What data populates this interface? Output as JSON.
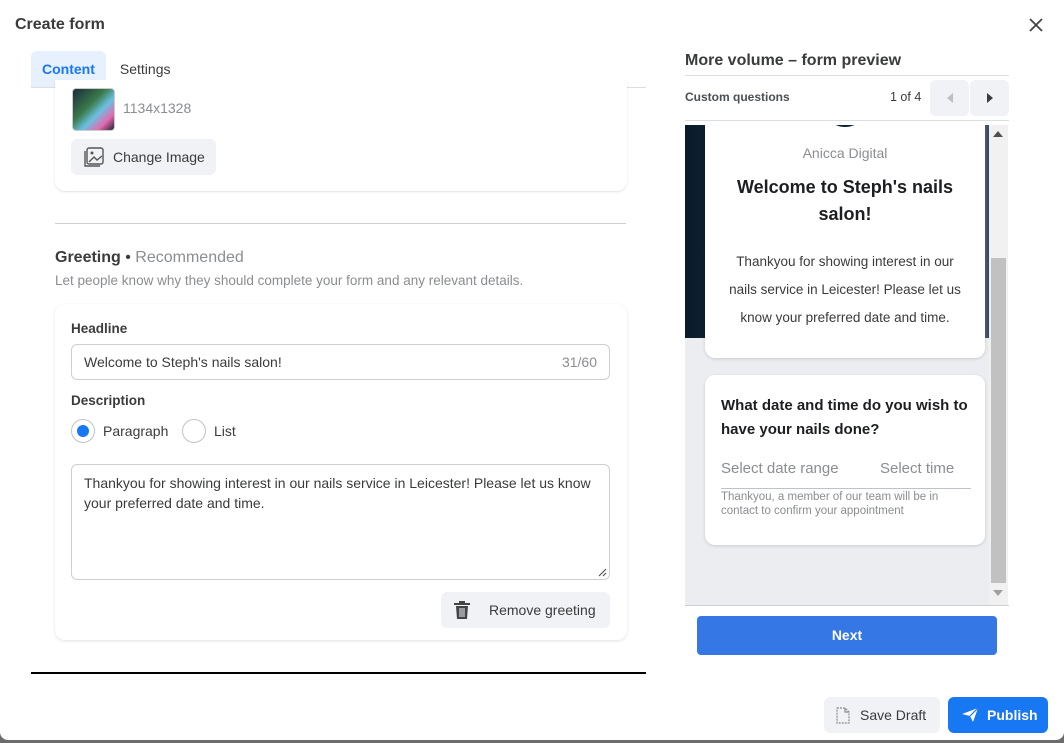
{
  "dialog": {
    "title": "Create form"
  },
  "tabs": [
    {
      "label": "Content",
      "active": true
    },
    {
      "label": "Settings",
      "active": false
    }
  ],
  "image_section": {
    "dimensions": "1134x1328",
    "change_label": "Change Image"
  },
  "greeting": {
    "title": "Greeting",
    "separator": " • ",
    "recommended": "Recommended",
    "subtitle": "Let people know why they should complete your form and any relevant details.",
    "headline_label": "Headline",
    "headline_value": "Welcome to Steph's nails salon!",
    "headline_counter": "31/60",
    "description_label": "Description",
    "radio_options": [
      {
        "label": "Paragraph",
        "selected": true
      },
      {
        "label": "List",
        "selected": false
      }
    ],
    "description_value": "Thankyou for showing interest in our nails service in Leicester! Please let us know your preferred date and time.",
    "remove_label": "Remove greeting"
  },
  "preview": {
    "title": "More volume – form preview",
    "section": "Custom questions",
    "page_indicator": "1 of 4",
    "brand": "Anicca Digital",
    "headline": "Welcome to Steph's nails salon!",
    "description": "Thankyou for showing interest in our nails service in Leicester! Please let us know your preferred date and time.",
    "question": "What date and time do you wish to have your nails done?",
    "date_placeholder": "Select date range",
    "time_placeholder": "Select time",
    "note": "Thankyou, a member of our team will be in contact to confirm your appointment",
    "next_label": "Next"
  },
  "footer": {
    "save_label": "Save Draft",
    "publish_label": "Publish"
  },
  "colors": {
    "accent": "#1877f2",
    "next_button": "#3578e5",
    "tab_active_bg": "#e7f0fd"
  }
}
